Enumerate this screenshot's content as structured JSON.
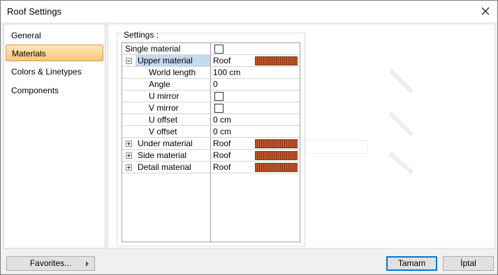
{
  "window": {
    "title": "Roof Settings"
  },
  "nav": {
    "items": [
      {
        "label": "General",
        "active": false
      },
      {
        "label": "Materials",
        "active": true
      },
      {
        "label": "Colors & Linetypes",
        "active": false
      },
      {
        "label": "Components",
        "active": false
      }
    ]
  },
  "settings": {
    "group_label": "Settings :",
    "rows": [
      {
        "name": "Single material",
        "value": ""
      },
      {
        "name": "Upper material",
        "value": "Roof"
      },
      {
        "name": "World length",
        "value": "100 cm"
      },
      {
        "name": "Angle",
        "value": "0"
      },
      {
        "name": "U mirror",
        "value": ""
      },
      {
        "name": "V mirror",
        "value": ""
      },
      {
        "name": "U offset",
        "value": "0 cm"
      },
      {
        "name": "V offset",
        "value": "0 cm"
      },
      {
        "name": "Under material",
        "value": "Roof"
      },
      {
        "name": "Side material",
        "value": "Roof"
      },
      {
        "name": "Detail material",
        "value": "Roof"
      }
    ],
    "swatch_color": "#b04a22"
  },
  "footer": {
    "favorites_label": "Favorites...",
    "ok_label": "Tamam",
    "cancel_label": "İptal"
  },
  "colors": {
    "accent": "#0078d7",
    "nav_active": "#f9c77a",
    "selection": "#c5d9f1"
  }
}
